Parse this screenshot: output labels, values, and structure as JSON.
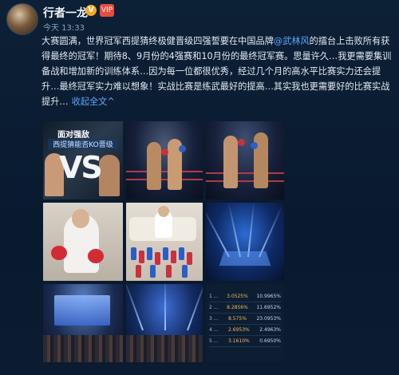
{
  "author": {
    "name": "行者一龙",
    "verified_badge": "V",
    "vip_badge": "VIP",
    "time": "今天 13:33"
  },
  "post": {
    "text_before_mention": "大赛圆满，世界冠军西提猜终极健晋级四强誓要在中国品牌",
    "mention": "@武林风",
    "text_after_mention": "的擂台上击败所有获得最终的冠军！期待8、9月份的4强赛和10月份的最终冠军赛。思量许久…我更需要集训备战和增加新的训练体系…因为每一位都很优秀，经过几个月的高水平比赛实力还会提升…最终冠军实力难以想象！实战比赛是练武最好的提高…其实我也更需要好的比赛实战提升…",
    "expand_label": "收起全文",
    "expand_caret": "^"
  },
  "photos": {
    "tile1": {
      "caption": "面对强敌",
      "subtitle": "西提猜能否KO晋级",
      "overlay": "VS"
    },
    "tile9": {
      "headers": [
        "",
        "",
        ""
      ],
      "rows": [
        {
          "label": "1 ...",
          "v1": "3.0525%",
          "v2": "10.9965%"
        },
        {
          "label": "2 ...",
          "v1": "8.2856%",
          "v2": "11.6952%"
        },
        {
          "label": "3 ...",
          "v1": "8.575%",
          "v2": "23.0953%"
        },
        {
          "label": "4 ...",
          "v1": "2.6953%",
          "v2": "2.4963%"
        },
        {
          "label": "5 ...",
          "v1": "3.1610%",
          "v2": "0.6950%"
        }
      ]
    }
  },
  "colors": {
    "link": "#5aa8ff",
    "glove_red": "#c8313d",
    "glove_blue": "#2b5fc7",
    "background": "#0a1a2e"
  }
}
